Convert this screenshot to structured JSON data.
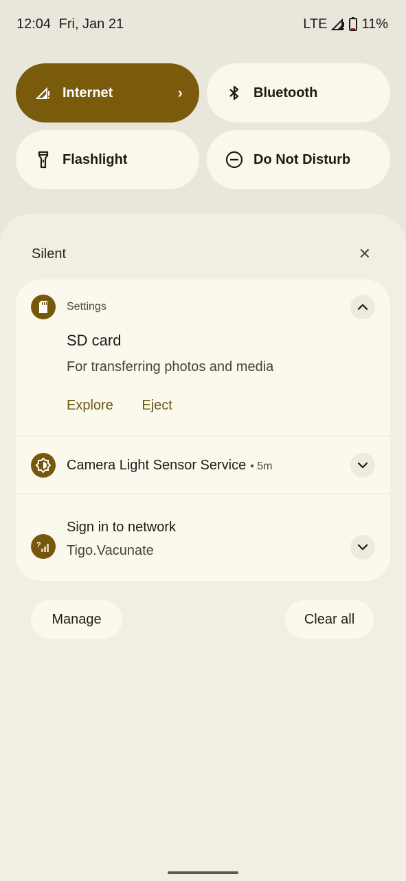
{
  "status_bar": {
    "time": "12:04",
    "date": "Fri, Jan 21",
    "network": "LTE",
    "battery": "11%"
  },
  "quick_settings": [
    {
      "label": "Internet",
      "icon": "signal-icon",
      "active": true
    },
    {
      "label": "Bluetooth",
      "icon": "bluetooth-icon",
      "active": false
    },
    {
      "label": "Flashlight",
      "icon": "flashlight-icon",
      "active": false
    },
    {
      "label": "Do Not Disturb",
      "icon": "do-not-disturb-icon",
      "active": false
    }
  ],
  "notifications_header": {
    "title": "Silent"
  },
  "notifications": [
    {
      "app": "Settings",
      "icon": "sd-card-icon",
      "title": "SD card",
      "body": "For transferring photos and media",
      "actions": [
        "Explore",
        "Eject"
      ]
    },
    {
      "title": "Camera Light Sensor Service",
      "meta": "• 5m",
      "icon": "light-sensor-icon"
    },
    {
      "title": "Sign in to network",
      "body": "Tigo.Vacunate",
      "icon": "wifi-question-icon"
    }
  ],
  "footer": {
    "manage": "Manage",
    "clear_all": "Clear all"
  },
  "colors": {
    "accent": "#7a5a0b",
    "background": "#e9e6dc",
    "shade": "#f2eee3",
    "card": "#fbf8ee",
    "action_text": "#6b5a10"
  }
}
